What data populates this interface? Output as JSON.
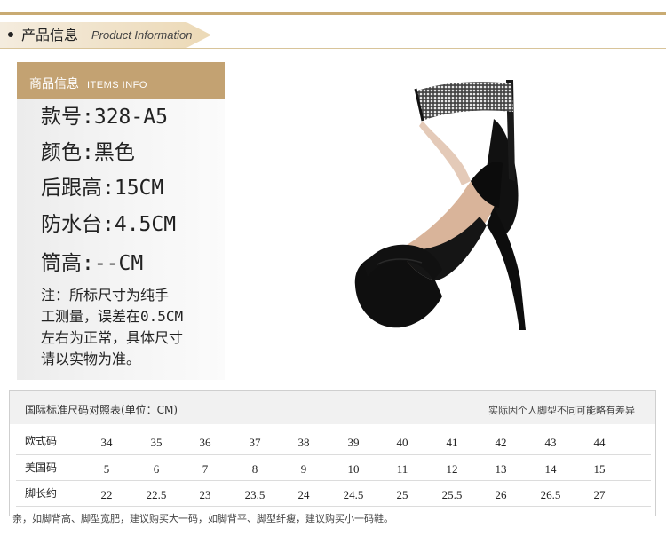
{
  "header": {
    "title_cn": "产品信息",
    "title_en": "Product Information"
  },
  "panel": {
    "head_cn": "商品信息",
    "head_en": "ITEMS INFO",
    "specs": [
      "款号:328-A5",
      "颜色:黑色",
      "后跟高:15CM",
      "防水台:4.5CM",
      "筒高:--CM"
    ],
    "note_lines": [
      "注：所标尺寸为纯手",
      "工测量，误差在0.5CM",
      "左右为正常，具体尺寸",
      "请以实物为准。"
    ]
  },
  "size_table": {
    "title": "国际标准尺码对照表(单位：CM)",
    "note": "实际因个人脚型不同可能略有差异",
    "rows": [
      {
        "label": "欧式码",
        "values": [
          "34",
          "35",
          "36",
          "37",
          "38",
          "39",
          "40",
          "41",
          "42",
          "43",
          "44"
        ]
      },
      {
        "label": "美国码",
        "values": [
          "5",
          "6",
          "7",
          "8",
          "9",
          "10",
          "11",
          "12",
          "13",
          "14",
          "15"
        ]
      },
      {
        "label": "脚长约",
        "values": [
          "22",
          "22.5",
          "23",
          "23.5",
          "24",
          "24.5",
          "25",
          "25.5",
          "26",
          "26.5",
          "27"
        ]
      }
    ]
  },
  "footer": "亲，如脚背高、脚型宽肥，建议购买大一码，如脚背平、脚型纤瘦，建议购买小一码鞋。",
  "colors": {
    "gold": "#c3a272",
    "gold_light": "#ecd9b6",
    "shoe": "#111111"
  }
}
